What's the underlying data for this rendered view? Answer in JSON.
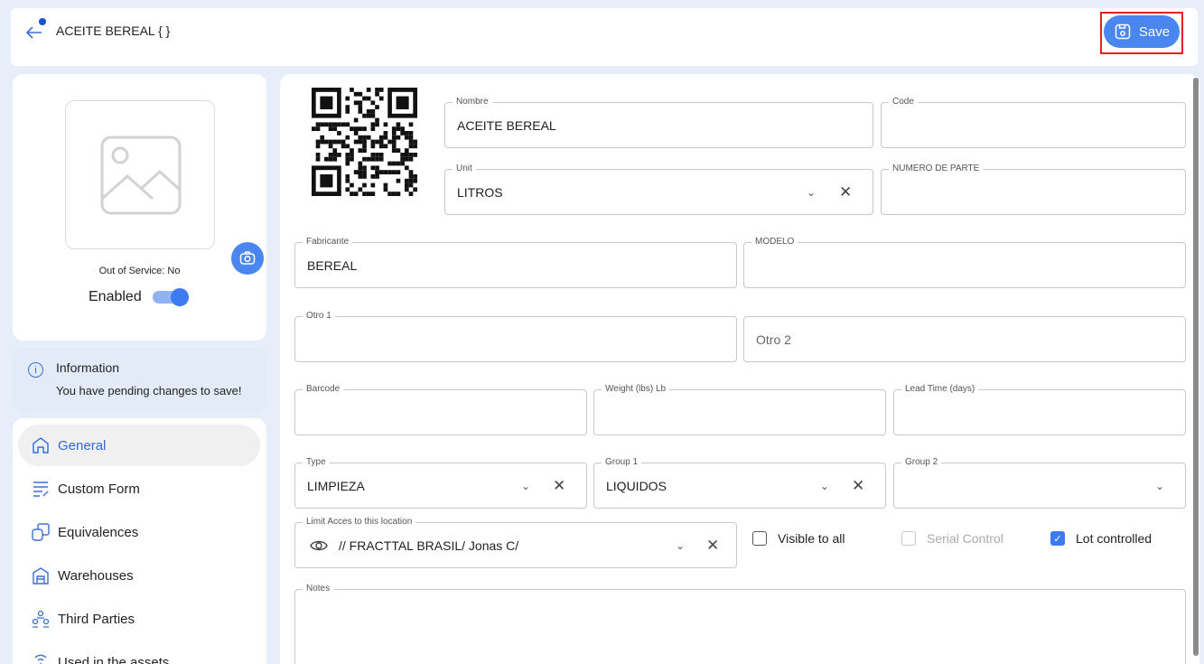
{
  "header": {
    "title": "ACEITE BEREAL { }",
    "save_label": "Save"
  },
  "asset": {
    "out_of_service": "Out of Service: No",
    "enabled_label": "Enabled"
  },
  "info": {
    "title": "Information",
    "message": "You have pending changes to save!"
  },
  "nav": [
    {
      "label": "General",
      "icon": "home-icon"
    },
    {
      "label": "Custom Form",
      "icon": "form-icon"
    },
    {
      "label": "Equivalences",
      "icon": "equivalence-icon"
    },
    {
      "label": "Warehouses",
      "icon": "warehouse-icon"
    },
    {
      "label": "Third Parties",
      "icon": "third-parties-icon"
    },
    {
      "label": "Used in the assets",
      "icon": "assets-icon"
    }
  ],
  "form": {
    "nombre": {
      "label": "Nombre",
      "value": "ACEITE BEREAL"
    },
    "code": {
      "label": "Code",
      "value": ""
    },
    "unit": {
      "label": "Unit",
      "value": "LITROS"
    },
    "numero_parte": {
      "label": "NUMERO DE PARTE",
      "value": ""
    },
    "fabricante": {
      "label": "Fabricante",
      "value": "BEREAL"
    },
    "modelo": {
      "label": "MODELO",
      "value": ""
    },
    "otro1": {
      "label": "Otro 1",
      "value": ""
    },
    "otro2": {
      "placeholder": "Otro 2"
    },
    "barcode": {
      "label": "Barcode",
      "value": ""
    },
    "weight": {
      "label": "Weight (lbs) Lb",
      "value": ""
    },
    "lead_time": {
      "label": "Lead Time (days)",
      "value": ""
    },
    "type": {
      "label": "Type",
      "value": "LIMPIEZA"
    },
    "group1": {
      "label": "Group 1",
      "value": "LIQUIDOS"
    },
    "group2": {
      "label": "Group 2",
      "value": ""
    },
    "location": {
      "label": "Limit Acces to this location",
      "value": "// FRACTTAL BRASIL/  Jonas C/"
    },
    "visible_to_all": {
      "label": "Visible to all",
      "checked": false
    },
    "serial_control": {
      "label": "Serial Control",
      "checked": false,
      "disabled": true
    },
    "lot_controlled": {
      "label": "Lot controlled",
      "checked": true
    },
    "notes": {
      "label": "Notes",
      "value": ""
    }
  },
  "colors": {
    "accent": "#4a86f0",
    "background": "#e8eef9",
    "info_bg": "#e3ebf8",
    "highlight": "#e02424"
  }
}
